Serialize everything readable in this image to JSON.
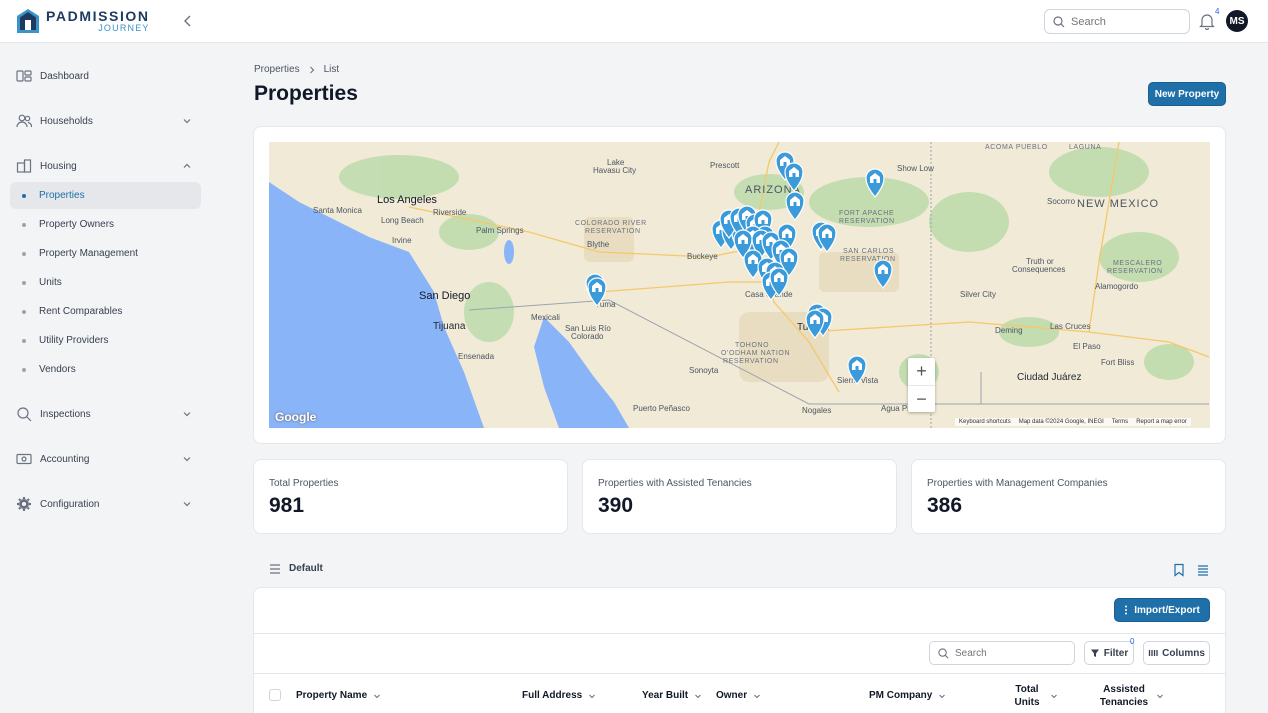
{
  "app": {
    "logo_line1": "PADMISSION",
    "logo_line2": "JOURNEY",
    "search_placeholder": "Search",
    "notification_count": "4",
    "avatar_initials": "MS"
  },
  "sidebar": {
    "items": [
      {
        "label": "Dashboard",
        "icon": "dashboard-icon"
      },
      {
        "label": "Households",
        "icon": "users-icon"
      },
      {
        "label": "Housing",
        "icon": "building-icon"
      },
      {
        "label": "Inspections",
        "icon": "search-icon"
      },
      {
        "label": "Accounting",
        "icon": "money-icon"
      },
      {
        "label": "Configuration",
        "icon": "gear-icon"
      }
    ],
    "housing_sub": [
      "Properties",
      "Property Owners",
      "Property Management",
      "Units",
      "Rent Comparables",
      "Utility Providers",
      "Vendors"
    ]
  },
  "page": {
    "breadcrumb": [
      "Properties",
      "List"
    ],
    "title": "Properties",
    "new_button": "New Property"
  },
  "map": {
    "labels": {
      "la": "Los Angeles",
      "santa_monica": "Santa Monica",
      "long_beach": "Long Beach",
      "irvine": "Irvine",
      "riverside": "Riverside",
      "palm_springs": "Palm Springs",
      "san_diego": "San Diego",
      "tijuana": "Tijuana",
      "ensenada": "Ensenada",
      "mexicali": "Mexicali",
      "yuma": "Yuma",
      "slrc1": "San Luis Río",
      "slrc2": "Colorado",
      "blythe": "Blythe",
      "buckeye": "Buckeye",
      "casa_grande": "Casa Grande",
      "tucson": "Tucson",
      "nogales": "Nogales",
      "sierra_vista": "Sierra Vista",
      "agua_prieta": "Agua Prieta",
      "sonoyta": "Sonoyta",
      "puerto_penasco": "Puerto Peñasco",
      "lake_havasu1": "Lake",
      "lake_havasu2": "Havasu City",
      "prescott": "Prescott",
      "show_low": "Show Low",
      "arizona": "ARIZONA",
      "new_mexico": "NEW MEXICO",
      "socorro": "Socorro",
      "truth1": "Truth or",
      "truth2": "Consequences",
      "alamogordo": "Alamogordo",
      "silver_city": "Silver City",
      "deming": "Deming",
      "las_cruces": "Las Cruces",
      "el_paso": "El Paso",
      "fort_bliss": "Fort Bliss",
      "ciudad_juarez": "Ciudad Juárez",
      "acoma": "ACOMA PUEBLO",
      "laguna": "LAGUNA",
      "colorado_river1": "COLORADO RIVER",
      "colorado_river2": "RESERVATION",
      "fort_apache1": "FORT APACHE",
      "fort_apache2": "RESERVATION",
      "san_carlos1": "SAN CARLOS",
      "san_carlos2": "RESERVATION",
      "tohono1": "TOHONO",
      "tohono2": "O'ODHAM NATION",
      "tohono3": "RESERVATION",
      "mescalero1": "MESCALERO",
      "mescalero2": "RESERVATION"
    },
    "google": "Google",
    "footer": [
      "Keyboard shortcuts",
      "Map data ©2024 Google, INEGI",
      "Terms",
      "Report a map error"
    ],
    "zoom_in": "+",
    "zoom_out": "−"
  },
  "stats": [
    {
      "label": "Total Properties",
      "value": "981"
    },
    {
      "label": "Properties with Assisted Tenancies",
      "value": "390"
    },
    {
      "label": "Properties with Management Companies",
      "value": "386"
    }
  ],
  "table": {
    "view_name": "Default",
    "import_export": "Import/Export",
    "search_placeholder": "Search",
    "filter_label": "Filter",
    "filter_count": "0",
    "columns_label": "Columns",
    "headers": [
      "Property Name",
      "Full Address",
      "Year Built",
      "Owner",
      "PM Company",
      "Total Units",
      "Assisted Tenancies"
    ]
  },
  "colors": {
    "primary": "#1f6fa8",
    "marker": "#3b9ad9",
    "water": "#8ab4f8"
  }
}
